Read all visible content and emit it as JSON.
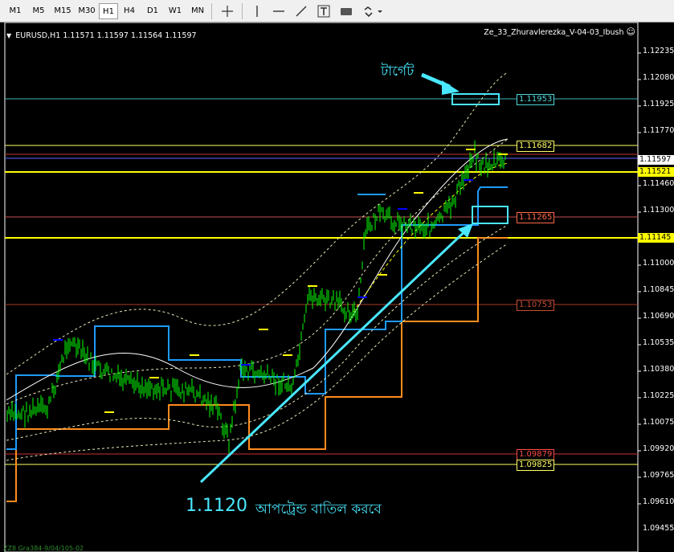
{
  "toolbar": {
    "timeframes": [
      "M1",
      "M5",
      "M15",
      "M30",
      "H1",
      "H4",
      "D1",
      "W1",
      "MN"
    ],
    "active_timeframe": "H1"
  },
  "chart": {
    "symbol_info": "EURUSD,H1  1.11571 1.11597 1.11564 1.11597",
    "indicator_name": "Ze_33_Zhuravlerezka_V-04-03_Ibush",
    "bottom_text": "ZZ8 Gra384-9/04/105-02",
    "price_axis": [
      "1.12235",
      "1.12080",
      "1.11925",
      "1.11770",
      "1.11460",
      "1.11300",
      "1.11000",
      "1.10845",
      "1.10690",
      "1.10535",
      "1.10380",
      "1.10225",
      "1.10075",
      "1.09920",
      "1.09765",
      "1.09610",
      "1.09455"
    ],
    "levels": [
      {
        "label": "1.11953",
        "color": "#4fd8d8"
      },
      {
        "label": "1.11682",
        "color": "#ffff64"
      },
      {
        "label": "1.11265",
        "color": "#ff6a4a"
      },
      {
        "label": "1.10753",
        "color": "#c84b32"
      },
      {
        "label": "1.09879",
        "color": "#ff4a4a"
      },
      {
        "label": "1.09825",
        "color": "#ffff64"
      }
    ],
    "current_price": "1.11597",
    "right_labels": [
      "1.11521",
      "1.11145"
    ],
    "colors": {
      "candles": "#00ff00",
      "blue_steps": "#1e9bff",
      "orange_steps": "#ff8c1e",
      "yellow_lines": "#ffff00",
      "cyan_annotation": "#49e8ff"
    }
  },
  "annotations": {
    "target": "টার্গেট",
    "note_price": "1.1120",
    "note_text": "আপট্রেন্ড বাতিল করবে"
  }
}
